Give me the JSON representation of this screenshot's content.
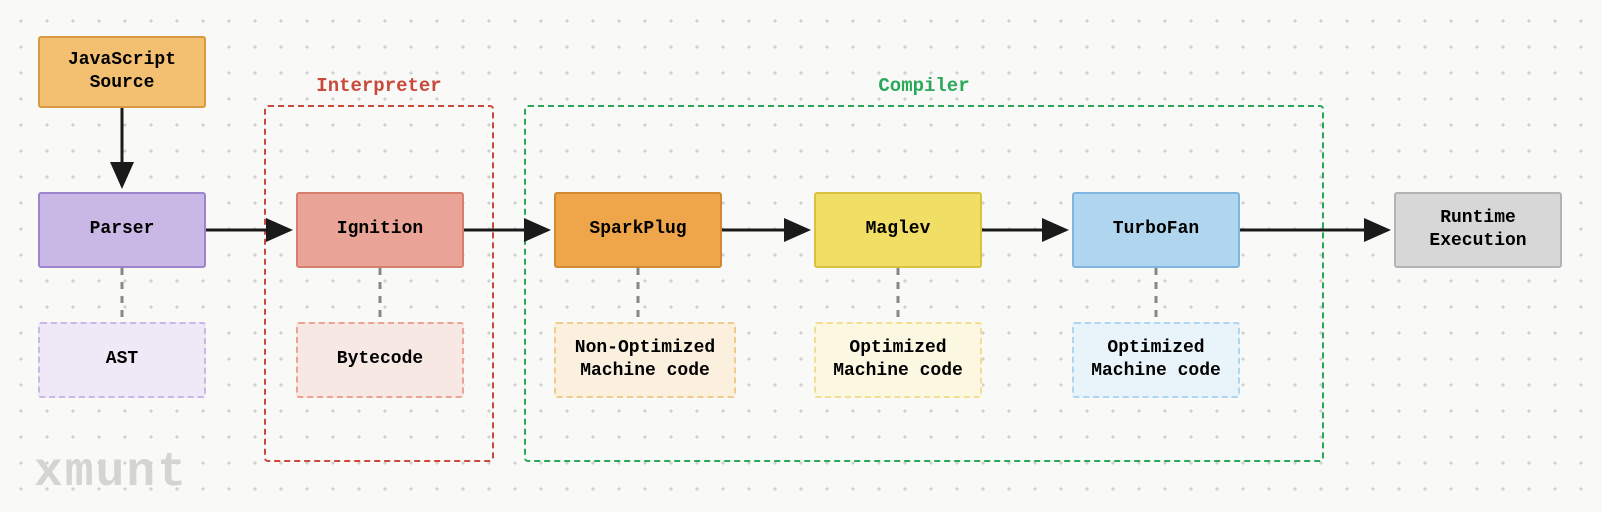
{
  "watermark": "xmunt",
  "groups": {
    "interpreter": {
      "label": "Interpreter",
      "color": "#c94a3b"
    },
    "compiler": {
      "label": "Compiler",
      "color": "#2aa85a"
    }
  },
  "nodes": {
    "js_source": {
      "label": "JavaScript\nSource",
      "bg": "#f3c071",
      "border": "#d89a40"
    },
    "parser": {
      "label": "Parser",
      "bg": "#c9b8e6",
      "border": "#9d84cc"
    },
    "ast": {
      "label": "AST",
      "bg": "#eee8f7",
      "border": "#c9b8e6"
    },
    "ignition": {
      "label": "Ignition",
      "bg": "#eaa397",
      "border": "#d67f6f"
    },
    "bytecode": {
      "label": "Bytecode",
      "bg": "#f7e8e4",
      "border": "#eaa397"
    },
    "sparkplug": {
      "label": "SparkPlug",
      "bg": "#efa64b",
      "border": "#d18932"
    },
    "nonopt": {
      "label": "Non-Optimized\nMachine code",
      "bg": "#faf0dd",
      "border": "#efcb8f"
    },
    "maglev": {
      "label": "Maglev",
      "bg": "#f1de64",
      "border": "#d8c23f"
    },
    "opt1": {
      "label": "Optimized\nMachine code",
      "bg": "#fbf7e1",
      "border": "#f1de94"
    },
    "turbofan": {
      "label": "TurboFan",
      "bg": "#b0d5ef",
      "border": "#7fb5de"
    },
    "opt2": {
      "label": "Optimized\nMachine code",
      "bg": "#e9f3fa",
      "border": "#b0d5ef"
    },
    "runtime": {
      "label": "Runtime\nExecution",
      "bg": "#d7d7d7",
      "border": "#b3b3b3"
    }
  },
  "colors": {
    "dash_line": "#888888",
    "arrow": "#1a1a1a"
  }
}
